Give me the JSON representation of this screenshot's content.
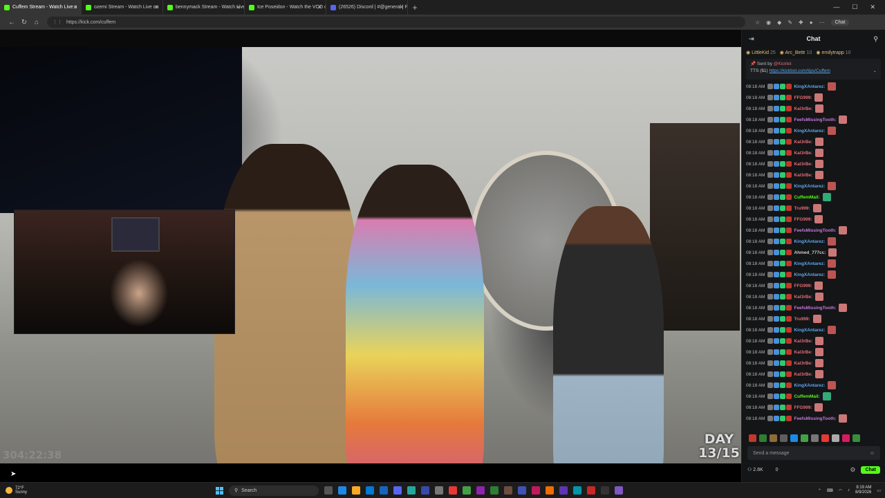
{
  "browser": {
    "tabs": [
      {
        "title": "Cuffem Stream - Watch Live o",
        "color": "#53fc18",
        "active": true
      },
      {
        "title": "ozemi Stream - Watch Live on",
        "color": "#53fc18",
        "active": false
      },
      {
        "title": "bennymack Stream - Watch Live",
        "color": "#53fc18",
        "active": false
      },
      {
        "title": "Ice Poseidon - Watch the VOD on",
        "color": "#53fc18",
        "active": false
      },
      {
        "title": "(26526) Discord | #@general | Pu",
        "color": "#5865f2",
        "active": false
      }
    ],
    "new_tab": "+",
    "url": "https://kick.com/cuffem",
    "chat_button": "Chat"
  },
  "player": {
    "uptime": "304:22:38",
    "day_label": "DAY",
    "day_count": "13/15"
  },
  "chat": {
    "title": "Chat",
    "leaderboard": [
      {
        "name": "LittleKid",
        "count": "25"
      },
      {
        "name": "Arc_Bettr",
        "count": "10"
      },
      {
        "name": "emilytrapp",
        "count": "10"
      }
    ],
    "pinned": {
      "sent_by_label": "Sent by",
      "sent_by_user": "@Kicklet",
      "tts_prefix": "TTS ($1)",
      "tts_link": "https://kickbot.com/tips/Cuffem"
    },
    "messages": [
      {
        "time": "08:18 AM",
        "user": "KingXAntarez:",
        "color": "#5da8f0"
      },
      {
        "time": "08:18 AM",
        "user": "FFG999:",
        "color": "#e06c75"
      },
      {
        "time": "08:18 AM",
        "user": "Kal3rBe:",
        "color": "#e06c75"
      },
      {
        "time": "08:18 AM",
        "user": "FeefsMissingTooth:",
        "color": "#c678dd"
      },
      {
        "time": "08:18 AM",
        "user": "KingXAntarez:",
        "color": "#5da8f0"
      },
      {
        "time": "08:18 AM",
        "user": "Kal3rBe:",
        "color": "#e06c75"
      },
      {
        "time": "08:18 AM",
        "user": "Kal3rBe:",
        "color": "#e06c75"
      },
      {
        "time": "08:18 AM",
        "user": "Kal3rBe:",
        "color": "#e06c75"
      },
      {
        "time": "08:18 AM",
        "user": "Kal3rBe:",
        "color": "#e06c75"
      },
      {
        "time": "08:18 AM",
        "user": "KingXAntarez:",
        "color": "#5da8f0"
      },
      {
        "time": "08:18 AM",
        "user": "CuffemMail:",
        "color": "#53fc18"
      },
      {
        "time": "08:18 AM",
        "user": "Tru999:",
        "color": "#e06c75"
      },
      {
        "time": "08:18 AM",
        "user": "FFG999:",
        "color": "#e06c75"
      },
      {
        "time": "08:18 AM",
        "user": "FeefsMissingTooth:",
        "color": "#c678dd"
      },
      {
        "time": "08:18 AM",
        "user": "KingXAntarez:",
        "color": "#5da8f0"
      },
      {
        "time": "08:18 AM",
        "user": "Ahmed_777cc:",
        "color": "#cccccc"
      },
      {
        "time": "08:18 AM",
        "user": "KingXAntarez:",
        "color": "#5da8f0"
      },
      {
        "time": "08:18 AM",
        "user": "KingXAntarez:",
        "color": "#5da8f0"
      },
      {
        "time": "08:18 AM",
        "user": "FFG999:",
        "color": "#e06c75"
      },
      {
        "time": "08:18 AM",
        "user": "Kal3rBe:",
        "color": "#e06c75"
      },
      {
        "time": "08:18 AM",
        "user": "FeefsMissingTooth:",
        "color": "#c678dd"
      },
      {
        "time": "08:18 AM",
        "user": "Tru999:",
        "color": "#e06c75"
      },
      {
        "time": "08:18 AM",
        "user": "KingXAntarez:",
        "color": "#5da8f0"
      },
      {
        "time": "08:18 AM",
        "user": "Kal3rBe:",
        "color": "#e06c75"
      },
      {
        "time": "08:18 AM",
        "user": "Kal3rBe:",
        "color": "#e06c75"
      },
      {
        "time": "08:18 AM",
        "user": "Kal3rBe:",
        "color": "#e06c75"
      },
      {
        "time": "08:18 AM",
        "user": "Kal3rBe:",
        "color": "#e06c75"
      },
      {
        "time": "08:18 AM",
        "user": "KingXAntarez:",
        "color": "#5da8f0"
      },
      {
        "time": "08:18 AM",
        "user": "CuffemMail:",
        "color": "#53fc18"
      },
      {
        "time": "08:18 AM",
        "user": "FFG999:",
        "color": "#e06c75"
      },
      {
        "time": "08:18 AM",
        "user": "FeefsMissingTooth:",
        "color": "#c678dd"
      }
    ],
    "input_placeholder": "Send a message",
    "viewers": "2.8K",
    "count": "0",
    "send_label": "Chat"
  },
  "taskbar": {
    "temp": "72°F",
    "condition": "Sunny",
    "search_label": "Search",
    "time": "8:19 AM",
    "date": "8/9/2026"
  },
  "colors": {
    "accent": "#53fc18"
  }
}
